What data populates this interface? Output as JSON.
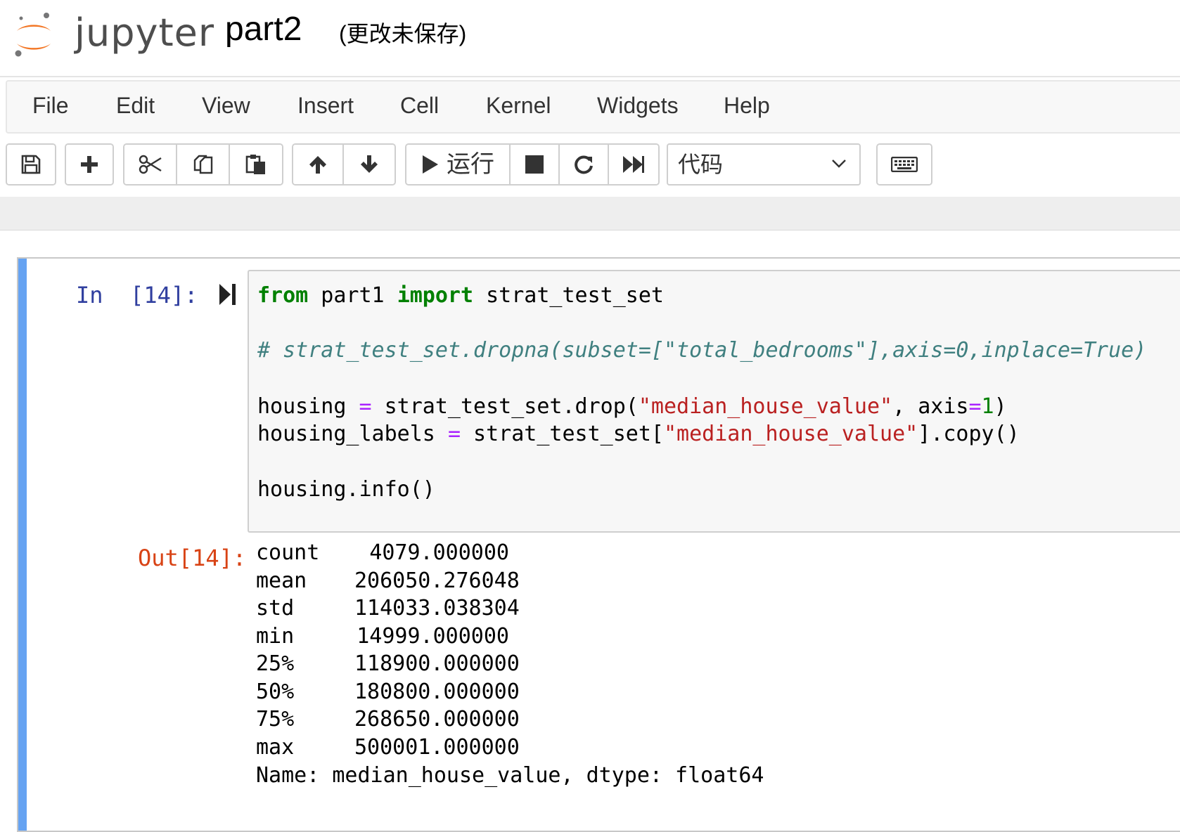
{
  "header": {
    "logo_text": "jupyter",
    "notebook_name": "part2",
    "save_status": "(更改未保存)"
  },
  "menu": {
    "items": [
      "File",
      "Edit",
      "View",
      "Insert",
      "Cell",
      "Kernel",
      "Widgets",
      "Help"
    ]
  },
  "toolbar": {
    "icons": [
      "save-icon",
      "plus-icon",
      "scissors-icon",
      "copy-icon",
      "paste-icon",
      "arrow-up-icon",
      "arrow-down-icon",
      "play-icon",
      "stop-icon",
      "restart-icon",
      "fast-forward-icon",
      "keyboard-icon"
    ],
    "run_label": "运行",
    "cell_type": "代码"
  },
  "cell": {
    "in_prompt": "In  [14]:",
    "out_prompt": "Out[14]:",
    "code": {
      "line1": {
        "kw1": "from",
        "mod": " part1 ",
        "kw2": "import",
        "name": " strat_test_set"
      },
      "line2": "# strat_test_set.dropna(subset=[\"total_bedrooms\"],axis=0,inplace=True)",
      "line3": {
        "a": "housing ",
        "op": "=",
        "b": " strat_test_set.drop(",
        "str": "\"median_house_value\"",
        "c": ", axis",
        "op2": "=",
        "num": "1",
        "d": ")"
      },
      "line4": {
        "a": "housing_labels ",
        "op": "=",
        "b": " strat_test_set[",
        "str": "\"median_house_value\"",
        "c": "].copy()"
      },
      "line5": "housing.info()"
    },
    "output": {
      "rows": [
        {
          "key": "count",
          "value": "4079.000000"
        },
        {
          "key": "mean",
          "value": "206050.276048"
        },
        {
          "key": "std",
          "value": "114033.038304"
        },
        {
          "key": "min",
          "value": "14999.000000"
        },
        {
          "key": "25%",
          "value": "118900.000000"
        },
        {
          "key": "50%",
          "value": "180800.000000"
        },
        {
          "key": "75%",
          "value": "268650.000000"
        },
        {
          "key": "max",
          "value": "500001.000000"
        }
      ],
      "footer": "Name: median_house_value, dtype: float64"
    }
  },
  "colors": {
    "selection_bar": "#66a3f2",
    "in_prompt": "#303f9f",
    "out_prompt": "#d84315",
    "logo_orange": "#f37726"
  }
}
